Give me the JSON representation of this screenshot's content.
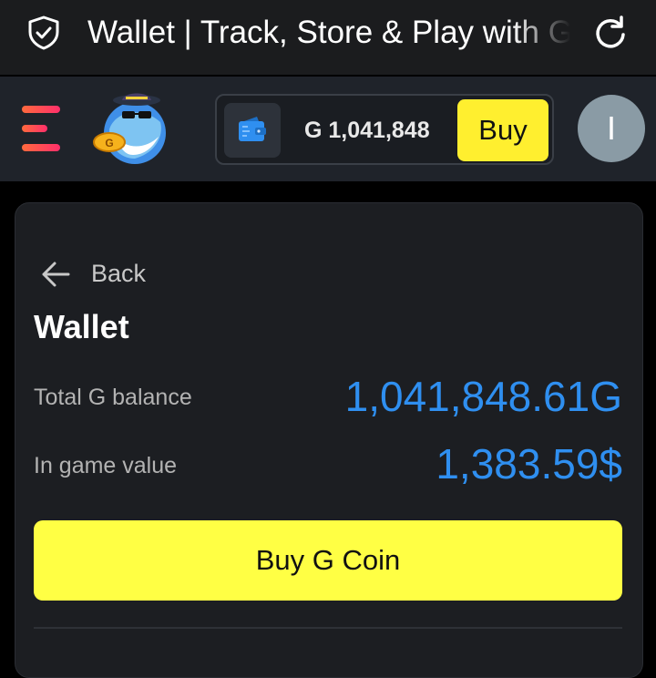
{
  "browser": {
    "tab_title": "Wallet | Track, Store & Play with G Coin",
    "icons": {
      "left": "shield-check-icon",
      "right": "reload-icon"
    }
  },
  "header": {
    "menu_icon": "hamburger-menu-icon",
    "logo": "shark-mascot-logo",
    "balance": "G 1,041,848",
    "buy_label": "Buy",
    "avatar_initial": "I",
    "colors": {
      "accent_yellow": "#ffef2f",
      "menu_gradient": [
        "#ff6a3d",
        "#ff2f6b"
      ],
      "wallet_icon": "#2f8ff0"
    }
  },
  "wallet": {
    "back_label": "Back",
    "title": "Wallet",
    "rows": [
      {
        "label": "Total G balance",
        "value": "1,041,848.61G"
      },
      {
        "label": "In game value",
        "value": "1,383.59$"
      }
    ],
    "buy_button": "Buy G Coin",
    "colors": {
      "value_blue": "#2f8ff0",
      "button_yellow": "#ffff44"
    }
  }
}
